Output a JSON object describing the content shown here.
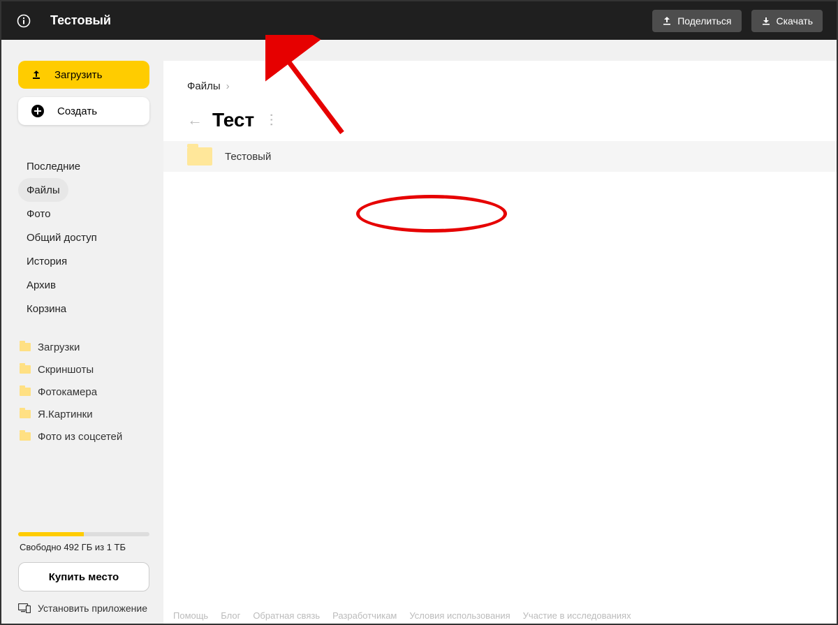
{
  "topbar": {
    "title": "Тестовый",
    "share_label": "Поделиться",
    "download_label": "Скачать"
  },
  "sidebar": {
    "upload_label": "Загрузить",
    "create_label": "Создать",
    "nav": [
      {
        "label": "Последние",
        "active": false
      },
      {
        "label": "Файлы",
        "active": true
      },
      {
        "label": "Фото",
        "active": false
      },
      {
        "label": "Общий доступ",
        "active": false
      },
      {
        "label": "История",
        "active": false
      },
      {
        "label": "Архив",
        "active": false
      },
      {
        "label": "Корзина",
        "active": false
      }
    ],
    "folders": [
      {
        "label": "Загрузки"
      },
      {
        "label": "Скриншоты"
      },
      {
        "label": "Фотокамера"
      },
      {
        "label": "Я.Картинки"
      },
      {
        "label": "Фото из соцсетей"
      }
    ],
    "storage_text": "Свободно 492 ГБ из 1 ТБ",
    "storage_fill_percent": 50,
    "buy_label": "Купить место",
    "install_label": "Установить приложение"
  },
  "main": {
    "breadcrumb": [
      "Файлы"
    ],
    "title": "Тест",
    "items": [
      {
        "name": "Тестовый",
        "type": "folder"
      }
    ]
  },
  "footer": [
    "Помощь",
    "Блог",
    "Обратная связь",
    "Разработчикам",
    "Условия использования",
    "Участие в исследованиях"
  ],
  "colors": {
    "accent": "#ffcc00",
    "annotation": "#e60000"
  }
}
